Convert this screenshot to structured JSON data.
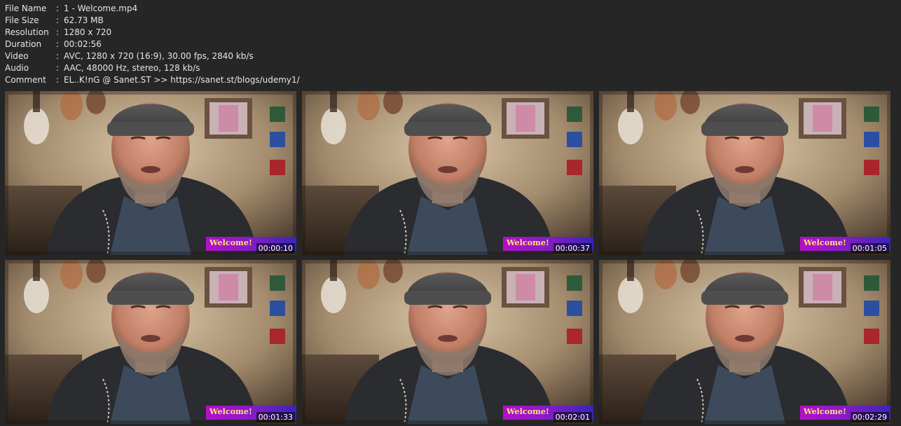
{
  "metadata": [
    {
      "key": "File Name",
      "sep": ":",
      "value": "1 - Welcome.mp4"
    },
    {
      "key": "File Size",
      "sep": ":",
      "value": "62.73 MB"
    },
    {
      "key": "Resolution",
      "sep": ":",
      "value": "1280 x 720"
    },
    {
      "key": "Duration",
      "sep": ":",
      "value": "00:02:56"
    },
    {
      "key": "Video",
      "sep": ":",
      "value": "AVC, 1280 x 720 (16:9), 30.00 fps, 2840 kb/s"
    },
    {
      "key": "Audio",
      "sep": ":",
      "value": "AAC, 48000 Hz, stereo, 128 kb/s"
    },
    {
      "key": "Comment",
      "sep": ":",
      "value": "EL..K!nG @ Sanet.ST >> https://sanet.st/blogs/udemy1/"
    }
  ],
  "thumbnails": [
    {
      "banner": "Welcome!",
      "timestamp": "00:00:10"
    },
    {
      "banner": "Welcome!",
      "timestamp": "00:00:37"
    },
    {
      "banner": "Welcome!",
      "timestamp": "00:01:05"
    },
    {
      "banner": "Welcome!",
      "timestamp": "00:01:33"
    },
    {
      "banner": "Welcome!",
      "timestamp": "00:02:01"
    },
    {
      "banner": "Welcome!",
      "timestamp": "00:02:29"
    }
  ],
  "colors": {
    "background": "#262626",
    "text": "#e6e6e6",
    "banner_start": "#b60fc9",
    "banner_end": "#3826b8",
    "banner_text": "#ffe47a"
  }
}
